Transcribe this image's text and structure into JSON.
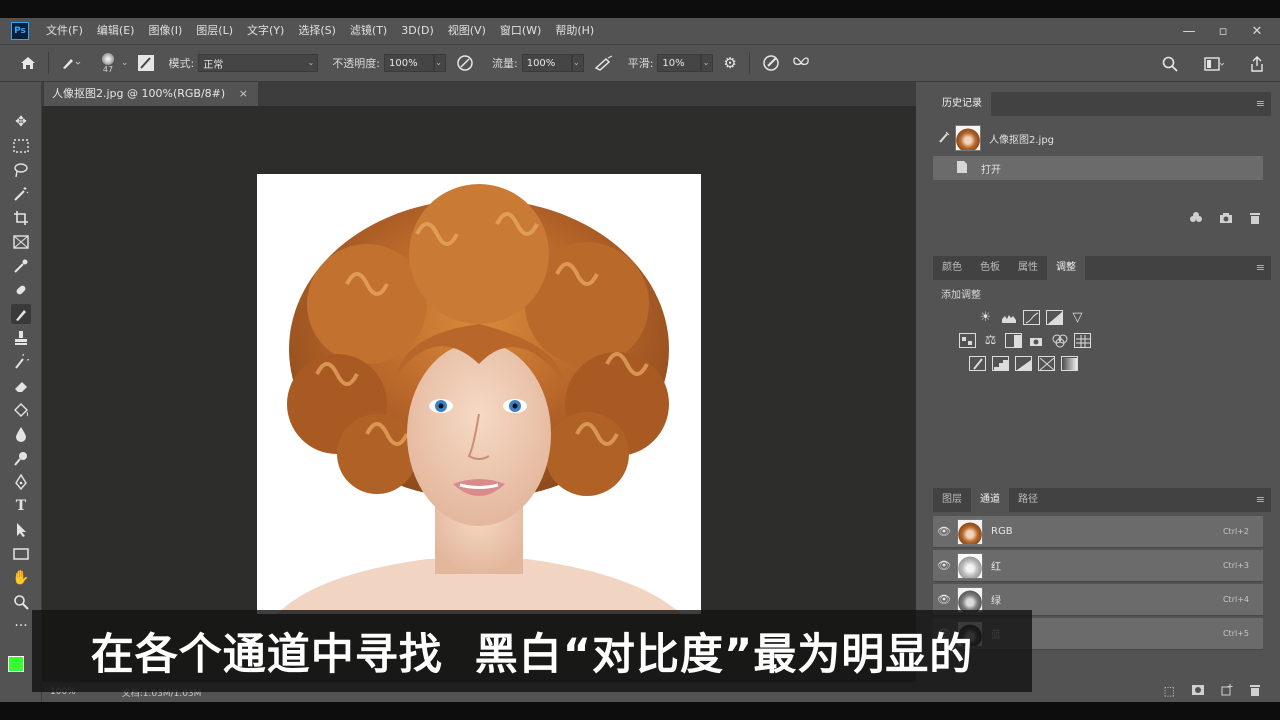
{
  "app": {
    "logo": "Ps",
    "menu": [
      "文件(F)",
      "编辑(E)",
      "图像(I)",
      "图层(L)",
      "文字(Y)",
      "选择(S)",
      "滤镜(T)",
      "3D(D)",
      "视图(V)",
      "窗口(W)",
      "帮助(H)"
    ],
    "window_controls": [
      "—",
      "▫",
      "✕"
    ]
  },
  "options": {
    "brush_size": "47",
    "mode_label": "模式:",
    "mode_value": "正常",
    "opacity_label": "不透明度:",
    "opacity_value": "100%",
    "flow_label": "流量:",
    "flow_value": "100%",
    "smoothing_label": "平滑:",
    "smoothing_value": "10%"
  },
  "document": {
    "tab_title": "人像抠图2.jpg @ 100%(RGB/8#)",
    "tab_close": "×",
    "zoom": "100%",
    "doc_info": "文档:1.03M/1.03M"
  },
  "colors": {
    "foreground": "#33ff33",
    "background": "#ffffff"
  },
  "history_panel": {
    "tab": "历史记录",
    "snapshot_name": "人像抠图2.jpg",
    "steps": [
      "打开"
    ]
  },
  "adjustments_panel": {
    "tabs": [
      "颜色",
      "色板",
      "属性",
      "调整"
    ],
    "active_tab": "调整",
    "heading": "添加调整",
    "icon_rows": [
      [
        "brightness-icon",
        "levels-icon",
        "curves-icon",
        "exposure-icon",
        "vibrance-icon"
      ],
      [
        "hue-sat-icon",
        "color-balance-icon",
        "black-white-icon",
        "photo-filter-icon",
        "channel-mixer-icon",
        "color-lookup-icon"
      ],
      [
        "invert-icon",
        "posterize-icon",
        "threshold-icon",
        "selective-color-icon",
        "gradient-map-icon"
      ]
    ]
  },
  "channels_panel": {
    "tabs": [
      "图层",
      "通道",
      "路径"
    ],
    "active_tab": "通道",
    "channels": [
      {
        "name": "RGB",
        "shortcut": "Ctrl+2",
        "selected": true
      },
      {
        "name": "红",
        "shortcut": "Ctrl+3",
        "selected": true
      },
      {
        "name": "绿",
        "shortcut": "Ctrl+4",
        "selected": true
      },
      {
        "name": "蓝",
        "shortcut": "Ctrl+5",
        "selected": true
      }
    ]
  },
  "subtitle": "在各个通道中寻找  黑白“对比度”最为明显的"
}
